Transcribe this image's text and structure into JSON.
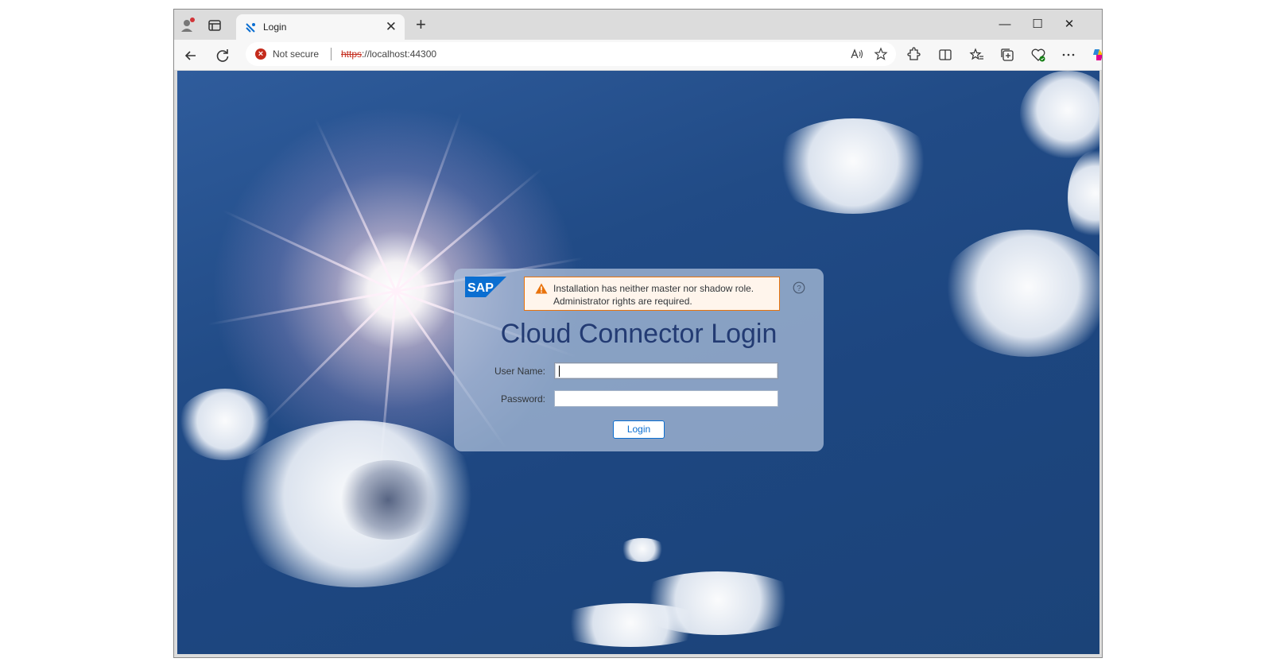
{
  "browser": {
    "tab_title": "Login",
    "tab_close": "✕",
    "new_tab": "+",
    "window_controls": {
      "minimize": "—",
      "maximize": "☐",
      "close": "✕"
    },
    "address": {
      "security_label": "Not secure",
      "url_scheme": "https",
      "url_rest": "://localhost:44300"
    }
  },
  "login": {
    "warning_line1": "Installation has neither master nor shadow role.",
    "warning_line2": "Administrator rights are required.",
    "title": "Cloud Connector Login",
    "username_label": "User Name:",
    "username_value": "",
    "password_label": "Password:",
    "password_value": "",
    "login_button": "Login",
    "logo_text": "SAP",
    "help_glyph": "?"
  },
  "colors": {
    "sap_blue": "#0a6ed1",
    "title_blue": "#233b73",
    "warning_orange": "#e9730c",
    "not_secure_red": "#c42b1c"
  }
}
